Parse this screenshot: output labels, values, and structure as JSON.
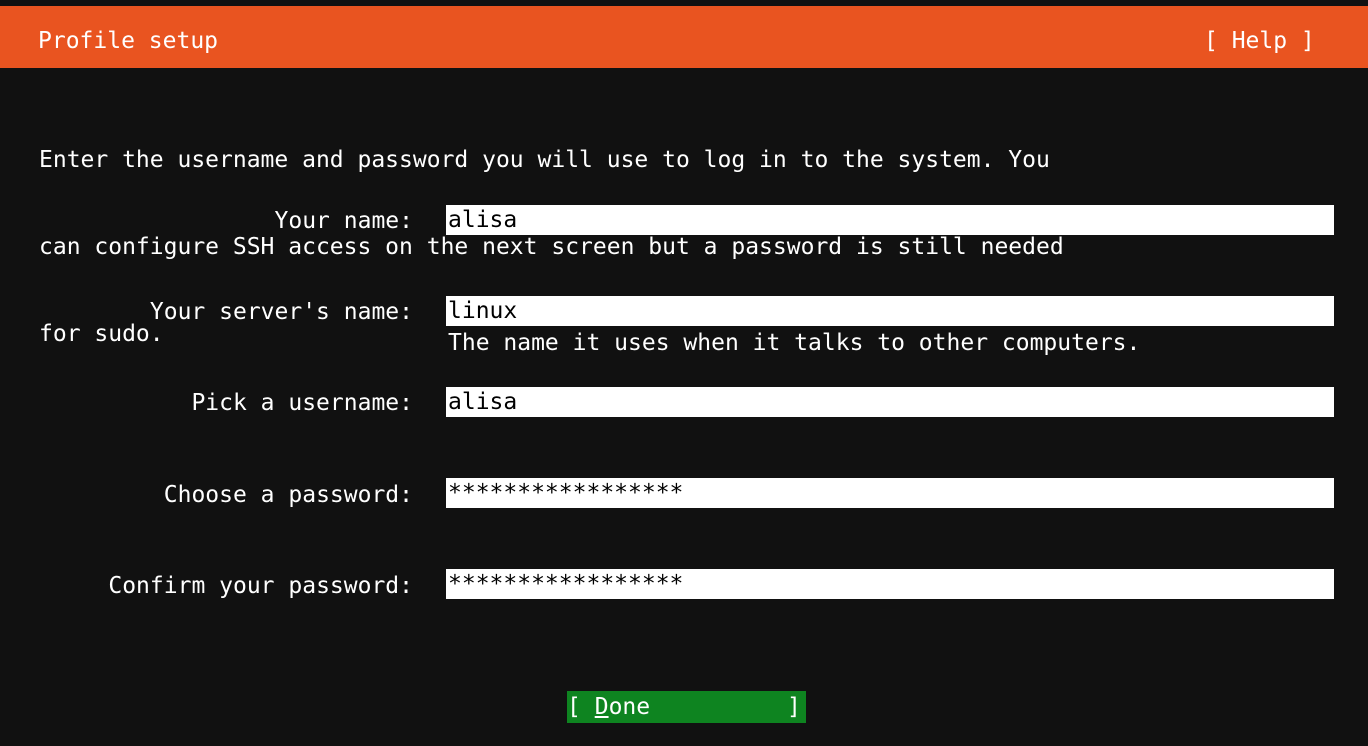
{
  "header": {
    "title": "Profile setup",
    "help_label": "[ Help ]",
    "background_color": "#e95420"
  },
  "intro": {
    "lines": [
      "Enter the username and password you will use to log in to the system. You",
      "can configure SSH access on the next screen but a password is still needed",
      "for sudo."
    ]
  },
  "form": {
    "fields": [
      {
        "label": "Your name:",
        "value": "alisa"
      },
      {
        "label": "Your server's name:",
        "value": "linux",
        "hint": "The name it uses when it talks to other computers."
      },
      {
        "label": "Pick a username:",
        "value": "alisa"
      },
      {
        "label": "Choose a password:",
        "value": "*****************"
      },
      {
        "label": "Confirm your password:",
        "value": "*****************"
      }
    ]
  },
  "actions": {
    "done_open": "[ ",
    "done_hotkey": "D",
    "done_rest": "one",
    "done_close": "]",
    "done_color": "#0e8420"
  }
}
